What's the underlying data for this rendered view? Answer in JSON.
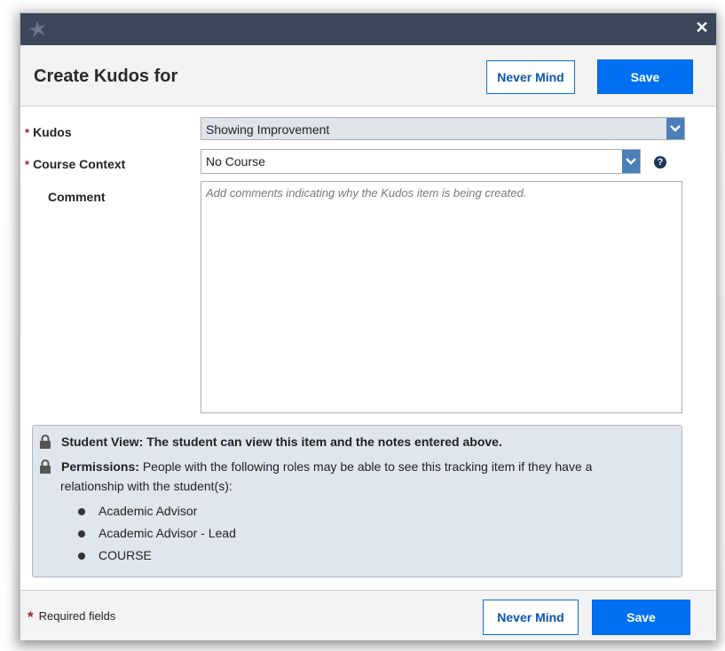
{
  "dialog": {
    "title": "Create Kudos for",
    "close_icon": "close-icon",
    "colors": {
      "titlebar": "#3b4658",
      "primary": "#0070f3",
      "accent": "#4a7fb9",
      "required": "#a0201c"
    }
  },
  "header": {
    "never_mind_label": "Never Mind",
    "save_label": "Save"
  },
  "form": {
    "kudos": {
      "label": "Kudos",
      "required_mark": "*",
      "value": "Showing Improvement"
    },
    "course_context": {
      "label": "Course Context",
      "required_mark": "*",
      "value": "No Course",
      "help_icon": "question-circle-icon"
    },
    "comment": {
      "label": "Comment",
      "placeholder": "Add comments indicating why the Kudos item is being created.",
      "value": ""
    }
  },
  "info": {
    "student_view_label": "Student View:",
    "student_view_text": "The student can view this item and the notes entered above.",
    "permissions_label": "Permissions:",
    "permissions_text_line1": "People with the following roles may be able to see this tracking item if they have a",
    "permissions_text_line2": "relationship with the student(s):",
    "roles": [
      "Academic Advisor",
      "Academic Advisor - Lead",
      "COURSE"
    ]
  },
  "footer": {
    "required_mark": "*",
    "required_text": "Required fields",
    "never_mind_label": "Never Mind",
    "save_label": "Save"
  }
}
